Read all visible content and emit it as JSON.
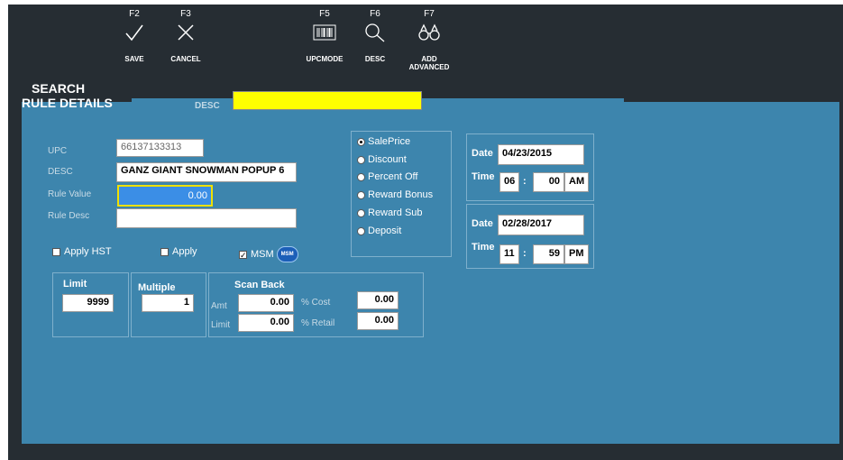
{
  "toolbar": {
    "save": {
      "key": "F2",
      "label": "SAVE"
    },
    "cancel": {
      "key": "F3",
      "label": "CANCEL"
    },
    "upcmode": {
      "key": "F5",
      "label": "UPCMODE"
    },
    "desc": {
      "key": "F6",
      "label": "DESC"
    },
    "add": {
      "key": "F7",
      "label1": "ADD",
      "label2": "ADVANCED"
    }
  },
  "headings": {
    "search": "SEARCH",
    "rule_details": "RULE DETAILS",
    "desc_label": "DESC"
  },
  "search_desc_value": "",
  "form": {
    "upc_label": "UPC",
    "upc_value": "66137133313",
    "desc_label": "DESC",
    "desc_value": "GANZ  GIANT SNOWMAN POPUP 6",
    "rule_value_label": "Rule Value",
    "rule_value": "0.00",
    "rule_desc_label": "Rule Desc",
    "rule_desc_value": ""
  },
  "checks": {
    "apply_hst": "Apply HST",
    "apply": "Apply",
    "msm": "MSM",
    "msm_badge": "MSM"
  },
  "radios": [
    "SalePrice",
    "Discount",
    "Percent Off",
    "Reward Bonus",
    "Reward  Sub",
    "Deposit"
  ],
  "dates": {
    "start": {
      "date_label": "Date",
      "date": "04/23/2015",
      "time_label": "Time",
      "hh": "06",
      "sep": ":",
      "mm": "00",
      "ampm": "AM"
    },
    "end": {
      "date_label": "Date",
      "date": "02/28/2017",
      "time_label": "Time",
      "hh": "11",
      "sep": ":",
      "mm": "59",
      "ampm": "PM"
    }
  },
  "limit": {
    "label": "Limit",
    "value": "9999"
  },
  "multiple": {
    "label": "Multiple",
    "value": "1"
  },
  "scan_back": {
    "title": "Scan Back",
    "amt_label": "Amt",
    "amt": "0.00",
    "limit_label": "Limit",
    "limit": "0.00",
    "cost_label": "% Cost",
    "cost": "0.00",
    "retail_label": "% Retail",
    "retail": "0.00"
  }
}
